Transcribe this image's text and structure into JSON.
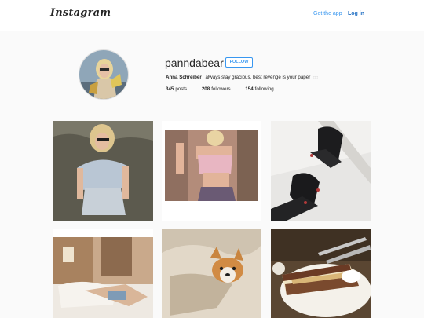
{
  "header": {
    "logo": "Instagram",
    "get_app": "Get the app",
    "login": "Log in"
  },
  "profile": {
    "username": "panndabear",
    "follow_label": "FOLLOW",
    "full_name": "Anna Schreiber",
    "bio": "always stay gracious, best revenge is your paper",
    "bio_emoji": "□□",
    "stats": {
      "posts_count": "345",
      "posts_label": "posts",
      "followers_count": "208",
      "followers_label": "followers",
      "following_count": "154",
      "following_label": "following"
    }
  },
  "colors": {
    "accent": "#3897f0",
    "background": "#fafafa",
    "text": "#262626"
  }
}
